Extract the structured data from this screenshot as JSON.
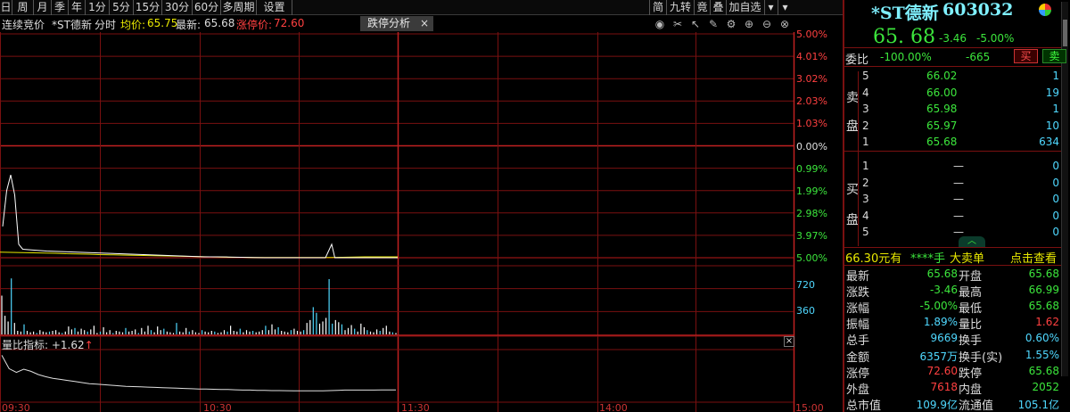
{
  "toolbar": {
    "periods": [
      "日",
      "周",
      "月",
      "季",
      "年",
      "1分",
      "5分",
      "15分",
      "30分",
      "60分",
      "多周期",
      "设置"
    ],
    "right": [
      "简",
      "九转",
      "竟",
      "叠",
      "加自选"
    ]
  },
  "info": {
    "mode": "连续竞价",
    "stock": "*ST德新",
    "view": "分时",
    "avg_label": "均价:",
    "avg_value": "65.75",
    "latest_label": "最新:",
    "latest_value": "65.68",
    "limit_label": "涨停价:",
    "limit_value": "72.60",
    "analysis_tab": "跌停分析",
    "close": "×"
  },
  "axis": {
    "right_pct": [
      "5.00%",
      "4.01%",
      "3.02%",
      "2.03%",
      "1.03%",
      "0.00%",
      "0.99%",
      "1.99%",
      "2.98%",
      "3.97%",
      "5.00%"
    ],
    "vol_ticks": [
      "720",
      "360"
    ],
    "times": [
      "09:30",
      "10:30",
      "11:30",
      "14:00",
      "15:00"
    ]
  },
  "indicator": {
    "label": "量比指标: +1.62",
    "arrow": "↑",
    "close": "×"
  },
  "chart_data": {
    "type": "line",
    "ylim_pct": [
      -5.0,
      5.0
    ],
    "price_pct": [
      -3.6,
      -2.0,
      -1.3,
      -2.2,
      -4.4,
      -4.62,
      -4.66,
      -4.7,
      -4.72,
      -4.74,
      -4.76,
      -4.78,
      -4.8,
      -4.82,
      -4.84,
      -4.86,
      -4.88,
      -4.9,
      -4.92,
      -4.94,
      -4.96,
      -4.96,
      -4.97,
      -4.98,
      -4.99,
      -5.0,
      -5.0,
      -5.0,
      -5.0,
      -5.0,
      -5.0,
      -4.7,
      -4.4,
      -5.0,
      -5.0,
      -5.0,
      -5.0
    ],
    "avg_pct": [
      -4.75,
      -4.76,
      -4.77,
      -4.78,
      -4.79,
      -4.8,
      -4.82,
      -4.83,
      -4.84,
      -4.86,
      -4.87,
      -4.88,
      -4.89,
      -4.9,
      -4.91,
      -4.92,
      -4.93,
      -4.94,
      -4.95,
      -4.96,
      -4.97,
      -4.98,
      -4.98,
      -4.99,
      -4.99,
      -4.99,
      -4.99,
      -4.99,
      -4.99,
      -4.99,
      -4.99,
      -4.98,
      -4.97,
      -4.96,
      -4.96,
      -4.96,
      -4.96
    ],
    "volume": [
      540,
      260,
      180,
      780,
      160,
      50,
      40,
      140,
      50,
      30,
      40,
      20,
      60,
      40,
      30,
      40,
      50,
      60,
      30,
      20,
      40,
      110,
      70,
      90,
      40,
      80,
      60,
      40,
      70,
      120,
      20,
      40,
      100,
      30,
      60,
      20,
      50,
      40,
      30,
      90,
      40,
      50,
      70,
      20,
      90,
      40,
      120,
      60,
      30,
      110,
      60,
      80,
      40,
      30,
      20,
      160,
      40,
      30,
      90,
      40,
      60,
      30,
      20,
      60,
      40,
      30,
      50,
      40,
      20,
      30,
      60,
      40,
      120,
      50,
      40,
      80,
      30,
      60,
      40,
      50,
      30,
      40,
      60,
      120,
      60,
      140,
      70,
      100,
      50,
      40,
      30,
      60,
      80,
      50,
      40,
      60,
      160,
      200,
      380,
      300,
      150,
      180,
      230,
      770,
      150,
      200,
      170,
      140,
      60,
      90,
      130,
      80,
      40,
      150,
      100,
      60,
      40,
      30,
      70,
      50,
      90,
      120,
      40,
      30,
      20
    ],
    "volume_ylim": [
      0,
      1080
    ],
    "qb_values": [
      8.6,
      6.1,
      5.4,
      6.0,
      5.6,
      5.0,
      4.6,
      4.3,
      4.1,
      3.9,
      3.7,
      3.5,
      3.3,
      3.2,
      3.1,
      3.0,
      2.9,
      2.8,
      2.75,
      2.7,
      2.65,
      2.6,
      2.55,
      2.5,
      2.45,
      2.4,
      2.35,
      2.3,
      2.3,
      2.25,
      2.2,
      2.2,
      2.15,
      2.1,
      2.1,
      2.05,
      2.05,
      2.0,
      2.0,
      1.98,
      1.96,
      1.95,
      1.95,
      1.95,
      1.95,
      2.0,
      2.05,
      2.1,
      2.1,
      2.1,
      2.1,
      2.1,
      2.12,
      2.12,
      2.12
    ],
    "qb_ylim": [
      0,
      10
    ]
  },
  "quote": {
    "name": "*ST德新",
    "code": "603032",
    "price": "65. 68",
    "change": "-3.46",
    "change_pct": "-5.00%",
    "wb_label": "委比",
    "wb_pct": "-100.00%",
    "wb_diff": "-665",
    "buy_btn": "买",
    "sell_btn": "卖",
    "sell_side_label": [
      "卖",
      "盘"
    ],
    "buy_side_label": [
      "买",
      "盘"
    ],
    "asks": [
      {
        "lvl": "5",
        "price": "66.02",
        "vol": "1"
      },
      {
        "lvl": "4",
        "price": "66.00",
        "vol": "19"
      },
      {
        "lvl": "3",
        "price": "65.98",
        "vol": "1"
      },
      {
        "lvl": "2",
        "price": "65.97",
        "vol": "10"
      },
      {
        "lvl": "1",
        "price": "65.68",
        "vol": "634"
      }
    ],
    "bids": [
      {
        "lvl": "1",
        "price": "—",
        "vol": "0"
      },
      {
        "lvl": "2",
        "price": "—",
        "vol": "0"
      },
      {
        "lvl": "3",
        "price": "—",
        "vol": "0"
      },
      {
        "lvl": "4",
        "price": "—",
        "vol": "0"
      },
      {
        "lvl": "5",
        "price": "—",
        "vol": "0"
      }
    ],
    "bigorder_price": "66.30元有",
    "bigorder_mask": "****手",
    "bigorder_label": "大卖单",
    "bigorder_link": "点击查看",
    "stats": [
      [
        "最新",
        "65.68",
        "开盘",
        "65.68"
      ],
      [
        "涨跌",
        "-3.46",
        "最高",
        "66.99"
      ],
      [
        "涨幅",
        "-5.00%",
        "最低",
        "65.68"
      ],
      [
        "振幅",
        "1.89%",
        "量比",
        "1.62"
      ],
      [
        "总手",
        "9669",
        "换手",
        "0.60%"
      ],
      [
        "金额",
        "6357万",
        "换手(实)",
        "1.55%"
      ],
      [
        "涨停",
        "72.60",
        "跌停",
        "65.68"
      ],
      [
        "外盘",
        "7618",
        "内盘",
        "2052"
      ],
      [
        "总市值",
        "109.9亿",
        "流通值",
        "105.1亿"
      ]
    ]
  },
  "colors": {
    "grid_red": "#7a1010",
    "price_line": "#ffffff",
    "avg_line": "#e8e800",
    "vol_up": "#ffffff",
    "vol_down": "#4fd8ff"
  }
}
